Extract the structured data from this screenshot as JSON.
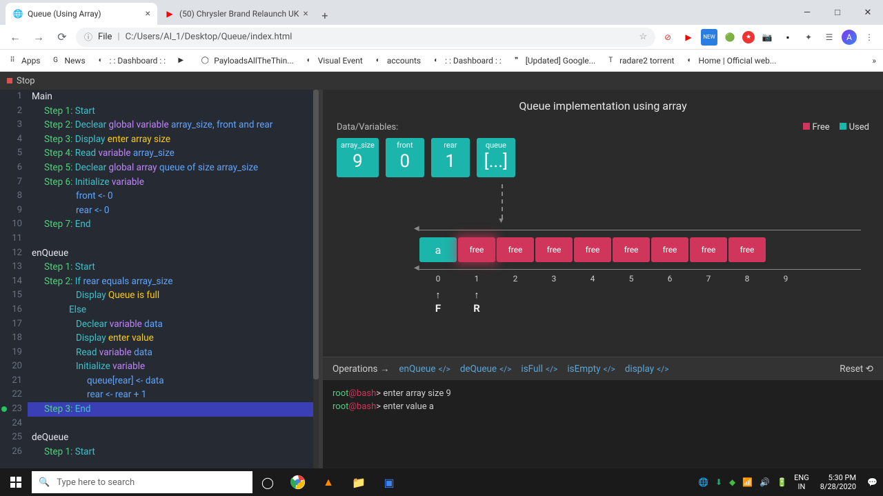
{
  "browser": {
    "tabs": [
      {
        "title": "Queue (Using Array)",
        "favicon": "🌐"
      },
      {
        "title": "(50) Chrysler Brand Relaunch UK",
        "favicon": "▶"
      }
    ],
    "url_label": "File",
    "url": "C:/Users/AI_1/Desktop/Queue/index.html",
    "bookmarks": [
      {
        "label": "Apps",
        "icon": "⠿"
      },
      {
        "label": "News",
        "icon": "G"
      },
      {
        "label": ": : Dashboard : :",
        "icon": "◐"
      },
      {
        "label": "",
        "icon": "▶"
      },
      {
        "label": "PayloadsAllTheThin...",
        "icon": "◯"
      },
      {
        "label": "Visual Event",
        "icon": "◐"
      },
      {
        "label": "accounts",
        "icon": "◐"
      },
      {
        "label": ": : Dashboard : :",
        "icon": "◐"
      },
      {
        "label": "[Updated] Google...",
        "icon": "❞"
      },
      {
        "label": "radare2 torrent",
        "icon": "T"
      },
      {
        "label": "Home | Official web...",
        "icon": "◐"
      }
    ]
  },
  "stop_label": "Stop",
  "code": {
    "lines": [
      {
        "n": 1,
        "html": "<span class='c-white'>Main</span>"
      },
      {
        "n": 2,
        "html": "<span class='i1'><span class='c-green'>Step 1: </span><span class='c-teal'>Start</span></span>"
      },
      {
        "n": 3,
        "html": "<span class='i1'><span class='c-green'>Step 2: </span><span class='c-teal'>Declear </span><span class='c-purple'>global variable </span><span class='c-blue'>array_size, front and rear</span></span>"
      },
      {
        "n": 4,
        "html": "<span class='i1'><span class='c-green'>Step 3: </span><span class='c-teal'>Display </span><span class='c-yellow'>enter array size</span></span>"
      },
      {
        "n": 5,
        "html": "<span class='i1'><span class='c-green'>Step 4: </span><span class='c-teal'>Read </span><span class='c-purple'>variable </span><span class='c-blue'>array_size</span></span>"
      },
      {
        "n": 6,
        "html": "<span class='i1'><span class='c-green'>Step 5: </span><span class='c-teal'>Declear </span><span class='c-purple'>global array </span><span class='c-blue'>queue of size array_size</span></span>"
      },
      {
        "n": 7,
        "html": "<span class='i1'><span class='c-green'>Step 6: </span><span class='c-teal'>Initialize </span><span class='c-purple'>variable</span></span>"
      },
      {
        "n": 8,
        "html": "<span class='i2'><span class='c-blue'>front &lt;- 0</span></span>"
      },
      {
        "n": 9,
        "html": "<span class='i2'><span class='c-blue'>rear &lt;- 0</span></span>"
      },
      {
        "n": 10,
        "html": "<span class='i1'><span class='c-green'>Step 7: </span><span class='c-teal'>End</span></span>"
      },
      {
        "n": 11,
        "html": ""
      },
      {
        "n": 12,
        "html": "<span class='c-white'>enQueue</span>"
      },
      {
        "n": 13,
        "html": "<span class='i1'><span class='c-green'>Step 1: </span><span class='c-teal'>Start</span></span>"
      },
      {
        "n": 14,
        "html": "<span class='i1'><span class='c-green'>Step 2: </span><span class='c-teal'>If </span><span class='c-blue'>rear equals array_size</span></span>"
      },
      {
        "n": 15,
        "html": "<span class='i2'><span class='c-teal'>Display </span><span class='c-yellow'>Queue is full</span></span>"
      },
      {
        "n": 16,
        "html": "<span class='i2 c-teal' style='padding-left:54px'>Else</span>"
      },
      {
        "n": 17,
        "html": "<span class='i2'><span class='c-teal'>Declear </span><span class='c-purple'>variable </span><span class='c-blue'>data</span></span>"
      },
      {
        "n": 18,
        "html": "<span class='i2'><span class='c-teal'>Display </span><span class='c-yellow'>enter value</span></span>"
      },
      {
        "n": 19,
        "html": "<span class='i2'><span class='c-teal'>Read </span><span class='c-purple'>variable </span><span class='c-blue'>data</span></span>"
      },
      {
        "n": 20,
        "html": "<span class='i2'><span class='c-teal'>Initialize </span><span class='c-purple'>variable</span></span>"
      },
      {
        "n": 21,
        "html": "<span class='i3'><span class='c-blue'>queue[rear] &lt;- data</span></span>"
      },
      {
        "n": 22,
        "html": "<span class='i3'><span class='c-blue'>rear &lt;- rear + 1</span></span>"
      },
      {
        "n": 23,
        "html": "<span class='i1'><span class='c-green'>Step 3: </span><span class='c-teal'>End</span></span>",
        "hl": true,
        "bp": true
      },
      {
        "n": 24,
        "html": ""
      },
      {
        "n": 25,
        "html": "<span class='c-white'>deQueue</span>"
      },
      {
        "n": 26,
        "html": "<span class='i1'><span class='c-green'>Step 1: </span><span class='c-teal'>Start</span></span>"
      }
    ]
  },
  "viz": {
    "title": "Queue implementation using array",
    "data_label": "Data/Variables:",
    "legend": {
      "free": "Free",
      "used": "Used"
    },
    "vars": [
      {
        "name": "array_size",
        "value": "9"
      },
      {
        "name": "front",
        "value": "0"
      },
      {
        "name": "rear",
        "value": "1"
      },
      {
        "name": "queue",
        "value": "[...]"
      }
    ],
    "cells": [
      {
        "label": "a",
        "state": "used"
      },
      {
        "label": "free",
        "state": "free",
        "glow": true
      },
      {
        "label": "free",
        "state": "free"
      },
      {
        "label": "free",
        "state": "free"
      },
      {
        "label": "free",
        "state": "free"
      },
      {
        "label": "free",
        "state": "free"
      },
      {
        "label": "free",
        "state": "free"
      },
      {
        "label": "free",
        "state": "free"
      },
      {
        "label": "free",
        "state": "free"
      }
    ],
    "indices": [
      "0",
      "1",
      "2",
      "3",
      "4",
      "5",
      "6",
      "7",
      "8",
      "9"
    ],
    "front_ptr": {
      "idx": 0,
      "label": "F"
    },
    "rear_ptr": {
      "idx": 1,
      "label": "R"
    }
  },
  "ops": {
    "label": "Operations",
    "items": [
      "enQueue",
      "deQueue",
      "isFull",
      "isEmpty",
      "display"
    ],
    "reset": "Reset"
  },
  "terminal": {
    "prompt_user": "root",
    "prompt_host": "bash",
    "lines": [
      "enter array size 9",
      "enter value a"
    ]
  },
  "taskbar": {
    "search_placeholder": "Type here to search",
    "lang": "ENG",
    "region": "IN",
    "time": "5:30 PM",
    "date": "8/28/2020"
  }
}
